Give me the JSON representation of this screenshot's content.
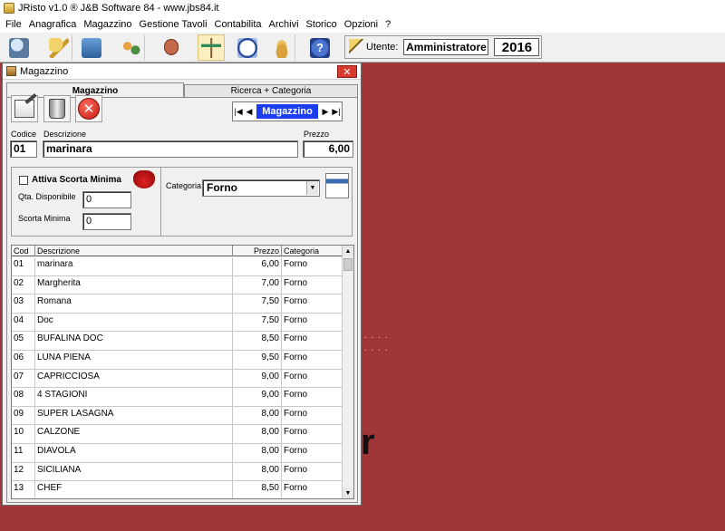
{
  "app": {
    "title": "JRisto v1.0 ® J&B Software 84 - www.jbs84.it",
    "menu": [
      "File",
      "Anagrafica",
      "Magazzino",
      "Gestione Tavoli",
      "Contabilita",
      "Archivi",
      "Storico",
      "Opzioni",
      "?"
    ],
    "user_label": "Utente:",
    "user_name": "Amministratore",
    "year": "2016",
    "help_glyph": "?"
  },
  "toolbar_icons": [
    "user-terminal-icon",
    "keys-icon",
    "trash-can-icon",
    "people-icon",
    "ham-icon",
    "table-icon",
    "clock-icon",
    "coins-icon",
    "help-icon"
  ],
  "window": {
    "title": "Magazzino",
    "close_glyph": "✕",
    "tabs": [
      "Magazzino",
      "Ricerca + Categoria"
    ],
    "navigator_label": "Magazzino",
    "nav_glyphs": {
      "first": "|◀",
      "prev": "◀",
      "next": "▶",
      "last": "▶|"
    },
    "cancel_glyph": "✕",
    "labels": {
      "codice": "Codice",
      "descrizione": "Descrizione",
      "prezzo": "Prezzo",
      "attiva_scorta": "Attiva Scorta Minima",
      "qta_disponibile": "Qta. Disponibile",
      "scorta_minima": "Scorta Minima",
      "categoria": "Categoria:"
    },
    "form": {
      "codice": "01",
      "descrizione": "marinara",
      "prezzo": "6,00",
      "qta_disponibile": "0",
      "scorta_minima": "0",
      "categoria": "Forno",
      "attiva_scorta_checked": false
    }
  },
  "grid": {
    "columns": [
      "Cod",
      "Descrizione",
      "Prezzo",
      "Categoria"
    ],
    "rows": [
      [
        "01",
        "marinara",
        "6,00",
        "Forno"
      ],
      [
        "02",
        "Margherita",
        "7,00",
        "Forno"
      ],
      [
        "03",
        "Romana",
        "7,50",
        "Forno"
      ],
      [
        "04",
        "Doc",
        "7,50",
        "Forno"
      ],
      [
        "05",
        "BUFALINA DOC",
        "8,50",
        "Forno"
      ],
      [
        "06",
        "LUNA PIENA",
        "9,50",
        "Forno"
      ],
      [
        "07",
        "CAPRICCIOSA",
        "9,00",
        "Forno"
      ],
      [
        "08",
        "4 STAGIONI",
        "9,00",
        "Forno"
      ],
      [
        "09",
        "SUPER LASAGNA",
        "8,00",
        "Forno"
      ],
      [
        "10",
        "CALZONE",
        "8,00",
        "Forno"
      ],
      [
        "11",
        "DIAVOLA",
        "8,00",
        "Forno"
      ],
      [
        "12",
        "SICILIANA",
        "8,00",
        "Forno"
      ],
      [
        "13",
        "CHEF",
        "8,50",
        "Forno"
      ]
    ]
  },
  "background": {
    "dots": ". . . .\n. . . .",
    "glyph": "r"
  },
  "colors": {
    "desktop": "#a0353a",
    "navigator": "#1a3ef0",
    "close": "#d83a2e"
  }
}
